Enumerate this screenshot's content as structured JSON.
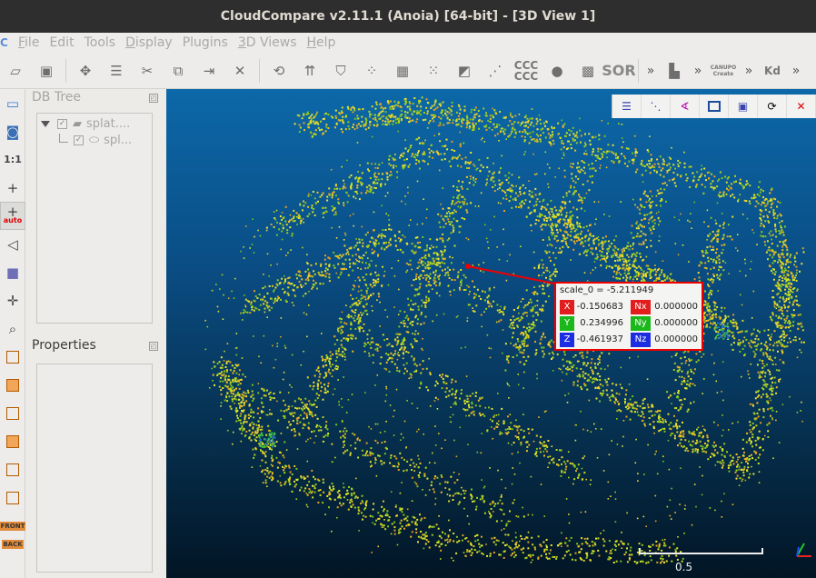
{
  "window": {
    "title": "CloudCompare v2.11.1 (Anoia) [64-bit] - [3D View 1]"
  },
  "menu": {
    "items": [
      {
        "label": "File",
        "u": "F",
        "rest": "ile"
      },
      {
        "label": "Edit",
        "u": "",
        "rest": "Edit"
      },
      {
        "label": "Tools",
        "u": "",
        "rest": "Tools"
      },
      {
        "label": "Display",
        "u": "D",
        "rest": "isplay"
      },
      {
        "label": "Plugins",
        "u": "",
        "rest": "Plugins"
      },
      {
        "label": "3D Views",
        "u": "3",
        "rest": "D Views"
      },
      {
        "label": "Help",
        "u": "H",
        "rest": "elp"
      }
    ]
  },
  "toolbar": {
    "icons": [
      "open-icon",
      "save-icon",
      "globe-icon",
      "list-icon",
      "scissors-icon",
      "crop-icon",
      "merge-icon",
      "delete-icon",
      "segment-icon",
      "normals-icon",
      "shield-icon",
      "sample-icon",
      "density-icon",
      "noise-icon",
      "distance-icon",
      "distance2-icon",
      "ccc-label",
      "blob-icon",
      "checker-icon",
      "sor-label"
    ],
    "ccc_label": "CCC CCC",
    "sor_label": "SOR",
    "canupo_label": "CANUPO Create",
    "kd_label": "Kd",
    "more": "»"
  },
  "left_toolbar": {
    "one_label": "1:1",
    "auto_label": "auto",
    "front_label": "FRONT",
    "back_label": "BACK"
  },
  "db_tree": {
    "title": "DB Tree",
    "items": [
      {
        "label": "splat...."
      },
      {
        "label": "spl..."
      }
    ]
  },
  "properties": {
    "title": "Properties"
  },
  "view": {
    "pick_label": {
      "header": "scale_0 = -5.211949",
      "rows": [
        {
          "axis": "X",
          "value": "-0.150683",
          "n_axis": "Nx",
          "n_value": "0.000000",
          "color": "#e21d1d",
          "n_color": "#e21d1d"
        },
        {
          "axis": "Y",
          "value": "0.234996",
          "n_axis": "Ny",
          "n_value": "0.000000",
          "color": "#1bb81b",
          "n_color": "#1bb81b"
        },
        {
          "axis": "Z",
          "value": "-0.461937",
          "n_axis": "Nz",
          "n_value": "0.000000",
          "color": "#1d2ee2",
          "n_color": "#1d2ee2"
        }
      ]
    },
    "scale_value": "0.5"
  }
}
